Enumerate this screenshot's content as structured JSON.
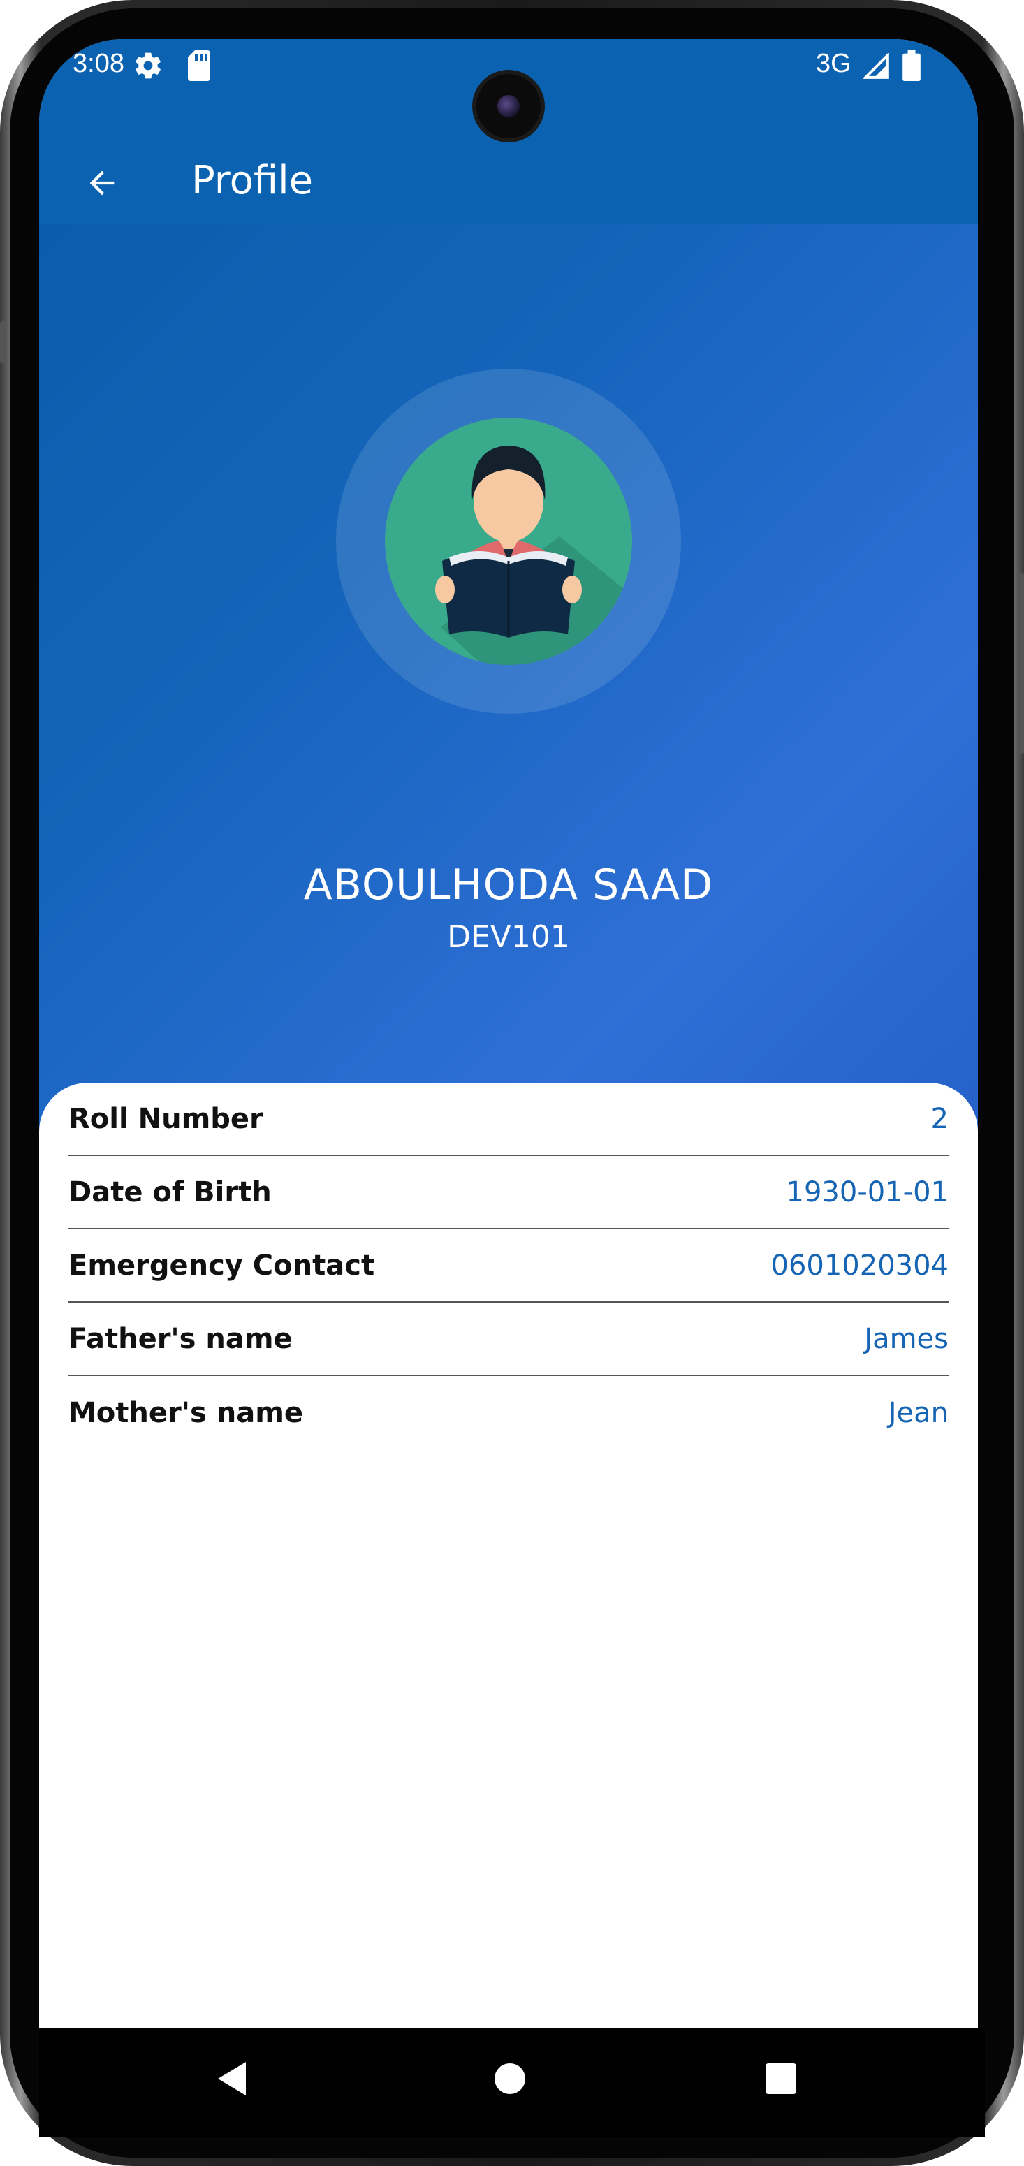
{
  "status_bar": {
    "time": "3:08",
    "network": "3G",
    "icons": [
      "gear-icon",
      "sd-card-icon",
      "signal-icon",
      "battery-icon"
    ]
  },
  "appbar": {
    "title": "Profile",
    "back_icon": "arrow-back-icon"
  },
  "profile": {
    "name": "ABOULHODA SAAD",
    "code": "DEV101",
    "avatar_icon": "student-reading-icon"
  },
  "details": [
    {
      "label": "Roll Number",
      "value": "2"
    },
    {
      "label": "Date of Birth",
      "value": "1930-01-01"
    },
    {
      "label": "Emergency Contact",
      "value": "0601020304"
    },
    {
      "label": "Father's name",
      "value": "James"
    },
    {
      "label": "Mother's name",
      "value": "Jean"
    }
  ],
  "navigation": {
    "buttons": [
      "back-nav-icon",
      "home-nav-icon",
      "recents-nav-icon"
    ]
  },
  "colors": {
    "appbar": "#0a62b0",
    "accent_value": "#1664b4",
    "avatar_bg": "#3aaa8c"
  }
}
